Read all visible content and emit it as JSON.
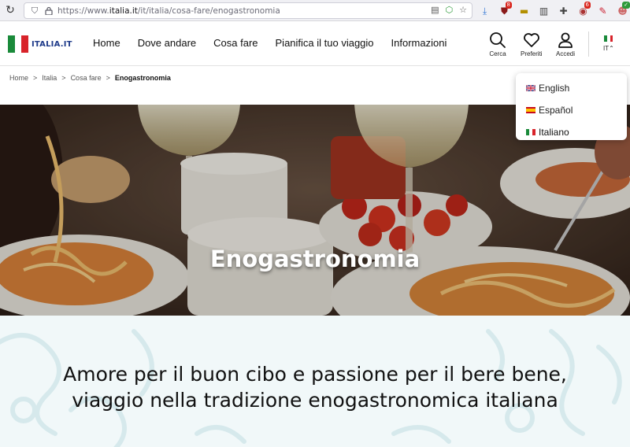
{
  "browser": {
    "url_prefix": "https://www.",
    "url_domain": "italia.it",
    "url_path": "/it/italia/cosa-fare/enogastronomia",
    "badges": {
      "ext1": "8",
      "ext2": "6"
    }
  },
  "header": {
    "logo_text": "ITALIA.IT",
    "nav": [
      "Home",
      "Dove andare",
      "Cosa fare",
      "Pianifica il tuo viaggio",
      "Informazioni"
    ],
    "actions": {
      "search": "Cerca",
      "favorites": "Preferiti",
      "login": "Accedi"
    },
    "lang_label": "IT"
  },
  "breadcrumb": [
    "Home",
    "Italia",
    "Cosa fare",
    "Enogastronomia"
  ],
  "language_dropdown": [
    {
      "label": "English",
      "flag": "uk"
    },
    {
      "label": "Español",
      "flag": "es"
    },
    {
      "label": "Italiano",
      "flag": "it"
    }
  ],
  "hero": {
    "title": "Enogastronomia"
  },
  "intro": {
    "heading": "Amore per il buon cibo e passione per il bere bene, viaggio nella tradizione enogastronomica italiana"
  },
  "colors": {
    "flag_green": "#1a8a3a",
    "flag_white": "#ffffff",
    "flag_red": "#d8232a",
    "logo_blue": "#1f3b8a",
    "intro_bg": "#f1f8f9"
  }
}
